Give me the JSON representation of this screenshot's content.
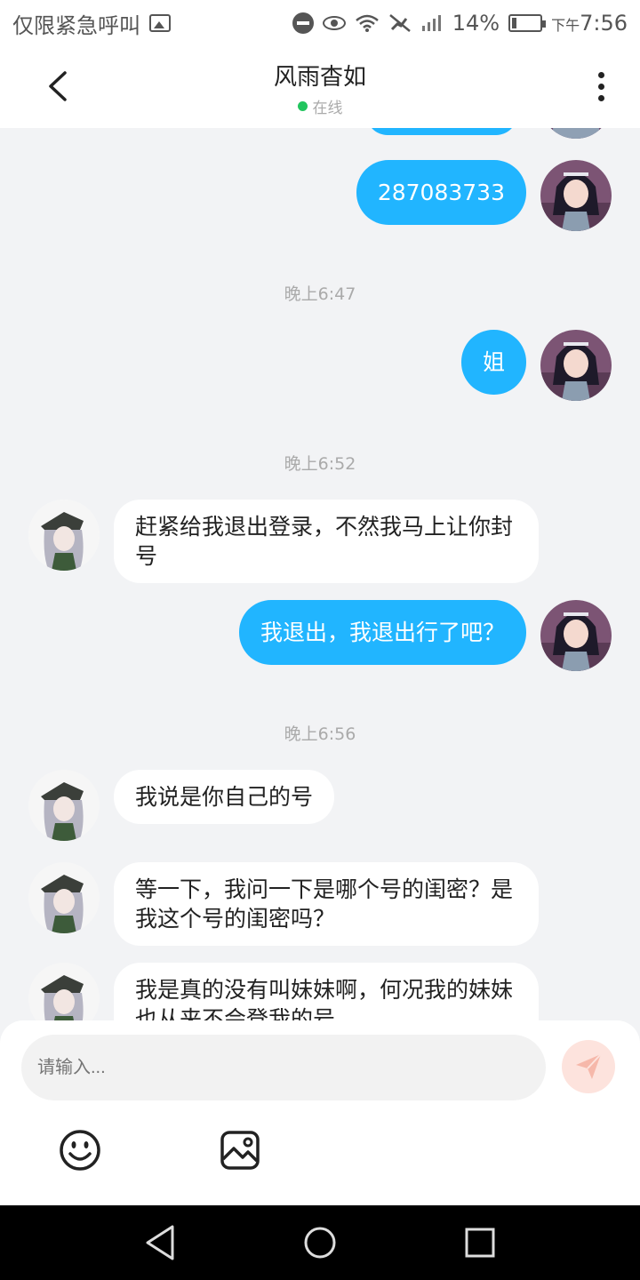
{
  "status_bar": {
    "carrier": "仅限紧急呼叫",
    "battery": "14%",
    "time_prefix": "下午",
    "time": "7:56"
  },
  "header": {
    "title": "风雨杳如",
    "presence": "在线"
  },
  "messages": [
    {
      "sender": "me",
      "text": "287083733"
    },
    {
      "timestamp": "晚上6:47"
    },
    {
      "sender": "me",
      "text": "姐"
    },
    {
      "timestamp": "晚上6:52"
    },
    {
      "sender": "them",
      "text": "赶紧给我退出登录，不然我马上让你封号"
    },
    {
      "sender": "me",
      "text": "我退出，我退出行了吧？"
    },
    {
      "timestamp": "晚上6:56"
    },
    {
      "sender": "them",
      "text": "我说是你自己的号"
    },
    {
      "sender": "them",
      "text": "等一下，我问一下是哪个号的闺密？是我这个号的闺密吗？"
    },
    {
      "sender": "them",
      "text": "我是真的没有叫妹妹啊，何况我的妹妹也从来不会登我的号"
    }
  ],
  "composer": {
    "placeholder": "请输入..."
  },
  "icons": {
    "back": "chevron-left-icon",
    "more": "more-vertical-icon",
    "send": "send-icon",
    "emoji": "emoji-icon",
    "image": "image-icon"
  },
  "colors": {
    "accent": "#21b5ff",
    "online": "#22c55e",
    "send_bg": "#fde3dd"
  }
}
